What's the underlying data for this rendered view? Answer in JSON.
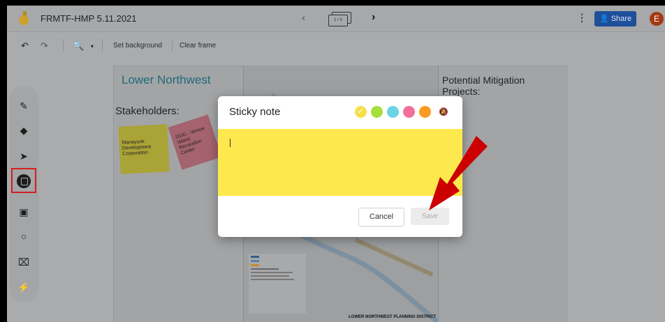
{
  "app": {
    "title": "FRMTF-HMP 5.11.2021"
  },
  "topbar": {
    "frame_indicator": "1 / 4",
    "share_label": "Share",
    "avatar_initial": "E",
    "icons": [
      "jamboard-logo-icon",
      "chevron-left-icon",
      "frames-icon",
      "chevron-right-icon",
      "more-vert-icon",
      "person-icon"
    ]
  },
  "toolbar": {
    "set_background_label": "Set background",
    "clear_frame_label": "Clear frame",
    "icons": [
      "undo-icon",
      "redo-icon",
      "zoom-icon",
      "caret-down-icon"
    ]
  },
  "side_tools": [
    "pen-icon",
    "eraser-icon",
    "select-icon",
    "sticky-note-icon",
    "image-icon",
    "circle-icon",
    "text-box-icon",
    "laser-icon"
  ],
  "canvas": {
    "region_title": "Lower Northwest",
    "stakeholders_label": "Stakeholders:",
    "sticky_yellow": "Manayunk Development Corporation",
    "sticky_pink": "DOG - Venice Island Recreation Center",
    "right_title": "Potential Mitigation Projects:",
    "map_caption": "LOWER NORTHWEST PLANNING DISTRICT"
  },
  "dialog": {
    "title": "Sticky note",
    "input_value": "",
    "cancel_label": "Cancel",
    "save_label": "Save",
    "colors": [
      "#f5e04a",
      "#a7e03c",
      "#6dd3e6",
      "#f36e9c",
      "#fb9a22"
    ],
    "selected_color": "#f5e04a",
    "note_color": "#fde94d"
  },
  "accent": {
    "share": "#1d4f9a",
    "avatar": "#a33a12",
    "arrow": "#cc0000",
    "highlight": "#d41e1e"
  }
}
